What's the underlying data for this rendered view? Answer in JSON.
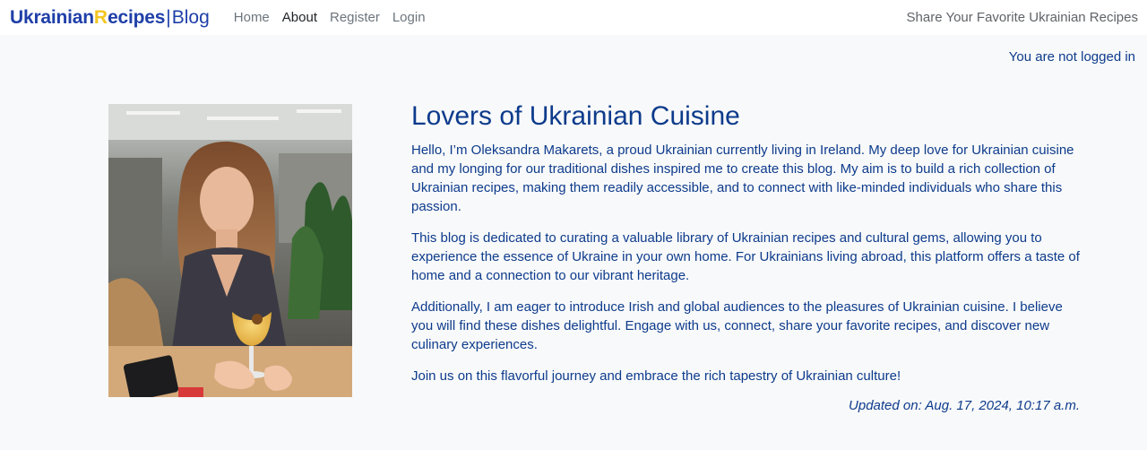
{
  "brand": {
    "part1": "Ukrainian",
    "part2": "R",
    "part3": "ecipes",
    "separator": "|",
    "part4": "Blog"
  },
  "nav": {
    "items": [
      {
        "label": "Home"
      },
      {
        "label": "About"
      },
      {
        "label": "Register"
      },
      {
        "label": "Login"
      }
    ],
    "active": "About"
  },
  "tagline": "Share Your Favorite Ukrainian Recipes",
  "login_status": "You are not logged in",
  "about": {
    "title": "Lovers of Ukrainian Cuisine",
    "paragraphs": [
      "Hello, I’m Oleksandra Makarets, a proud Ukrainian currently living in Ireland. My deep love for Ukrainian cuisine and my longing for our traditional dishes inspired me to create this blog. My aim is to build a rich collection of Ukrainian recipes, making them readily accessible, and to connect with like-minded individuals who share this passion.",
      "This blog is dedicated to curating a valuable library of Ukrainian recipes and cultural gems, allowing you to experience the essence of Ukraine in your own home. For Ukrainians living abroad, this platform offers a taste of home and a connection to our vibrant heritage.",
      "Additionally, I am eager to introduce Irish and global audiences to the pleasures of Ukrainian cuisine. I believe you will find these dishes delightful. Engage with us, connect, share your favorite recipes, and discover new culinary experiences.",
      "Join us on this flavorful journey and embrace the rich tapestry of Ukrainian culture!"
    ],
    "updated": "Updated on: Aug. 17, 2024, 10:17 a.m."
  },
  "colors": {
    "primary_text": "#0d3b8c",
    "brand_blue": "#1f3fa8",
    "brand_yellow": "#f3c623",
    "page_bg": "#f8f9fa"
  }
}
